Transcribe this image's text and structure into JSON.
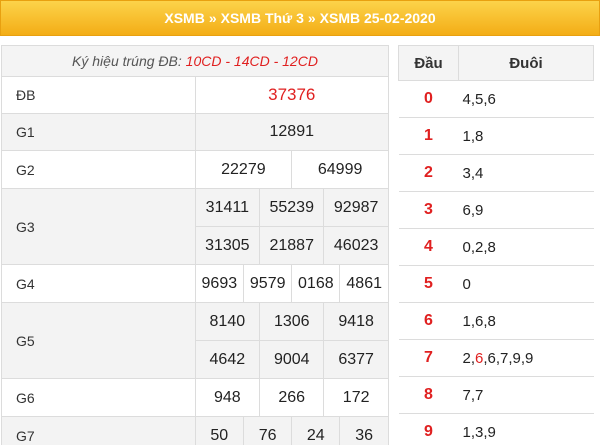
{
  "header": {
    "crumbs": [
      "XSMB",
      "XSMB Thứ 3",
      "XSMB 25-02-2020"
    ],
    "separator": "»"
  },
  "kyhieu": {
    "label": "Ký hiệu trúng ĐB:",
    "codes": "10CD - 14CD - 12CD"
  },
  "prizes": {
    "db": {
      "label": "ĐB",
      "numbers": [
        "37376"
      ]
    },
    "g1": {
      "label": "G1",
      "numbers": [
        "12891"
      ]
    },
    "g2": {
      "label": "G2",
      "numbers": [
        "22279",
        "64999"
      ]
    },
    "g3": {
      "label": "G3",
      "numbers": [
        "31411",
        "55239",
        "92987",
        "31305",
        "21887",
        "46023"
      ]
    },
    "g4": {
      "label": "G4",
      "numbers": [
        "9693",
        "9579",
        "0168",
        "4861"
      ]
    },
    "g5": {
      "label": "G5",
      "numbers": [
        "8140",
        "1306",
        "9418",
        "4642",
        "9004",
        "6377"
      ]
    },
    "g6": {
      "label": "G6",
      "numbers": [
        "948",
        "266",
        "172"
      ]
    },
    "g7": {
      "label": "G7",
      "numbers": [
        "50",
        "76",
        "24",
        "36"
      ]
    }
  },
  "loto": {
    "head_label": "Đầu",
    "tail_label": "Đuôi",
    "rows": [
      {
        "dau": "0",
        "duoi": "4,5,6"
      },
      {
        "dau": "1",
        "duoi": "1,8"
      },
      {
        "dau": "2",
        "duoi": "3,4"
      },
      {
        "dau": "3",
        "duoi": "6,9"
      },
      {
        "dau": "4",
        "duoi": "0,2,8"
      },
      {
        "dau": "5",
        "duoi": "0"
      },
      {
        "dau": "6",
        "duoi": "1,6,8"
      },
      {
        "dau": "7",
        "duoi_pre": "2,",
        "duoi_hl": "6",
        "duoi_post": ",6,7,9,9"
      },
      {
        "dau": "8",
        "duoi": "7,7"
      },
      {
        "dau": "9",
        "duoi": "1,3,9"
      }
    ]
  },
  "colors": {
    "header_bg": "#f3ad16",
    "accent_red": "#e02020",
    "border": "#dcdcdc"
  }
}
